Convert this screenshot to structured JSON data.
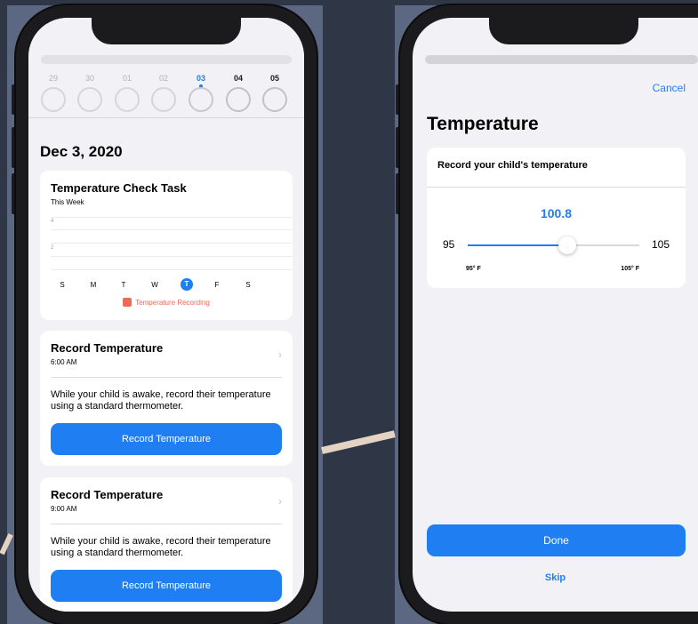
{
  "left_screen": {
    "week_days": [
      {
        "num": "29",
        "state": "past"
      },
      {
        "num": "30",
        "state": "past"
      },
      {
        "num": "01",
        "state": "past"
      },
      {
        "num": "02",
        "state": "past"
      },
      {
        "num": "03",
        "state": "selected"
      },
      {
        "num": "04",
        "state": "future"
      },
      {
        "num": "05",
        "state": "future"
      }
    ],
    "date_heading": "Dec 3, 2020",
    "chart_card": {
      "title": "Temperature Check Task",
      "subtitle": "This Week",
      "y_labels": [
        "4",
        "2"
      ],
      "weekdays": [
        "S",
        "M",
        "T",
        "W",
        "T",
        "F",
        "S"
      ],
      "legend": "Temperature Recording",
      "legend_color": "#eb6b55"
    },
    "tasks": [
      {
        "title": "Record Temperature",
        "time": "6:00 AM",
        "body": "While your child is awake, record their temperature using a standard thermometer.",
        "button": "Record Temperature"
      },
      {
        "title": "Record Temperature",
        "time": "9:00 AM",
        "body": "While your child is awake, record their temperature using a standard thermometer.",
        "button": "Record Temperature"
      }
    ]
  },
  "right_screen": {
    "cancel": "Cancel",
    "title": "Temperature",
    "prompt": "Record your child's temperature",
    "value": "100.8",
    "min": "95",
    "max": "105",
    "min_label": "95° F",
    "max_label": "105° F",
    "slider_fraction": 0.58,
    "done": "Done",
    "skip": "Skip"
  },
  "colors": {
    "accent": "#1f7ff2",
    "background": "#2f3747",
    "screen": "#f2f2f6"
  }
}
